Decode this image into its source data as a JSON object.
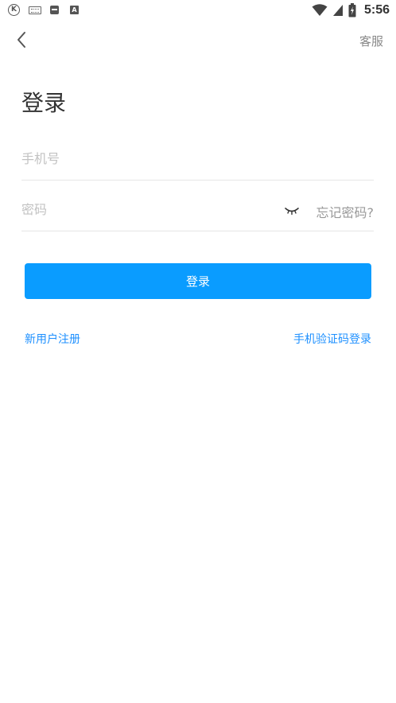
{
  "status_bar": {
    "time": "5:56",
    "icons": [
      "k-circle-icon",
      "keyboard-icon",
      "message-icon",
      "a-box-icon",
      "wifi-icon",
      "signal-icon",
      "battery-icon"
    ],
    "k_label": "K",
    "a_label": "A"
  },
  "header": {
    "back_icon": "chevron-left-icon",
    "service_label": "客服"
  },
  "page": {
    "title": "登录"
  },
  "form": {
    "phone": {
      "placeholder": "手机号",
      "value": ""
    },
    "password": {
      "placeholder": "密码",
      "value": "",
      "toggle_icon": "eye-closed-icon"
    },
    "forgot_label": "忘记密码?",
    "submit_label": "登录"
  },
  "links": {
    "register_label": "新用户注册",
    "sms_login_label": "手机验证码登录"
  },
  "colors": {
    "primary": "#0a9cff",
    "link": "#1e90ff",
    "placeholder": "#c2c2c2",
    "divider": "#e6e6e6",
    "title": "#333333"
  }
}
